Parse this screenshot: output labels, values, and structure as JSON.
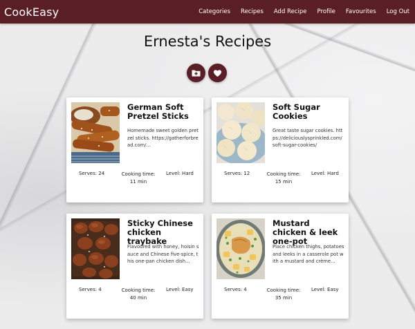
{
  "navbar": {
    "brand": "CookEasy",
    "links": [
      "Categories",
      "Recipes",
      "Add Recipe",
      "Profile",
      "Favourites",
      "Log Out"
    ]
  },
  "page": {
    "title": "Ernesta's Recipes"
  },
  "actions": {
    "add_icon": "folder-plus-icon",
    "favourite_icon": "heart-icon"
  },
  "colors": {
    "primary": "#5a1e27"
  },
  "recipes": [
    {
      "title": "German Soft Pretzel Sticks",
      "description": "Homemade sweet golden pretzel sticks. https://gatherforbread.com/...",
      "serves": "Serves: 24",
      "time_label": "Cooking time:",
      "time_value": "11 min",
      "level": "Level: Hard"
    },
    {
      "title": "Soft Sugar Cookies",
      "description": "Great taste sugar cookies. https://deliciouslysprinkled.com/soft-sugar-cookies/",
      "serves": "Serves: 12",
      "time_label": "Cooking time:",
      "time_value": "15 min",
      "level": "Level: Hard"
    },
    {
      "title": "Sticky Chinese chicken traybake",
      "description": "Flavoured with honey, hoisin sauce and Chinese five-spice, this one-pan chicken dish...",
      "serves": "Serves: 4",
      "time_label": "Cooking time:",
      "time_value": "40 min",
      "level": "Level: Easy"
    },
    {
      "title": "Mustard chicken & leek one-pot",
      "description": "Place chicken thighs, potatoes and leeks in a casserole pot with a mustard and crème...",
      "serves": "Serves: 4",
      "time_label": "Cooking time:",
      "time_value": "35 min",
      "level": "Level: Easy"
    }
  ]
}
